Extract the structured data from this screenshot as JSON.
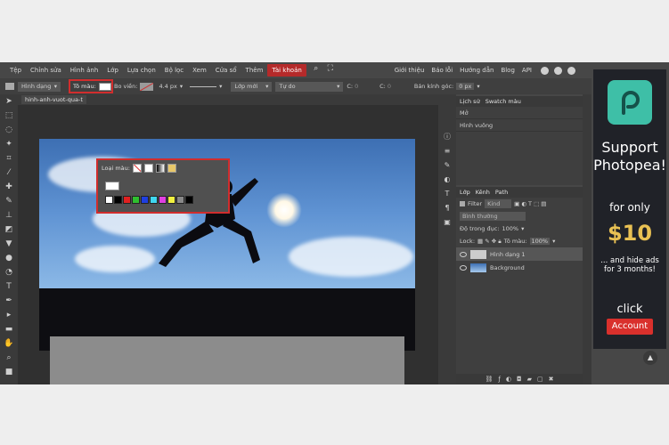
{
  "menu": {
    "items": [
      "Tệp",
      "Chỉnh sửa",
      "Hình ảnh",
      "Lớp",
      "Lựa chọn",
      "Bộ lọc",
      "Xem",
      "Cửa sổ",
      "Thêm",
      "Tài khoản"
    ],
    "right_items": [
      "Giới thiệu",
      "Báo lỗi",
      "Hướng dẫn",
      "Blog",
      "API"
    ]
  },
  "options": {
    "shape_mode": "Hình dạng",
    "fill_label": "Tô màu:",
    "stroke_label": "Bo viền:",
    "stroke_size": "4.4 px",
    "layer_mode": "Lớp mới",
    "free_mode": "Tự do",
    "w_label": "C:",
    "w_value": "0",
    "h_label": "C:",
    "h_value": "0",
    "radius_label": "Bán kính góc:",
    "radius_value": "0 px"
  },
  "document": {
    "tab_name": "hinh-anh-vuot-qua-t"
  },
  "popup": {
    "title": "Loại màu:",
    "swatches": [
      "#ffffff",
      "#000000",
      "#e02020",
      "#2fbf2f",
      "#1f3fe0",
      "#3fd7f0",
      "#e040e0",
      "#f0f040",
      "#888888",
      "#000000"
    ]
  },
  "history": {
    "tabs": [
      "Lịch sử",
      "Swatch màu"
    ],
    "rows": [
      "Mở",
      "Hình vuông"
    ]
  },
  "layers": {
    "tabs": [
      "Lớp",
      "Kênh",
      "Path"
    ],
    "filter_label": "Filter",
    "kind_label": "Kind",
    "blend": "Bình thường",
    "opacity_label": "Độ trong đục:",
    "opacity_value": "100%",
    "lock_label": "Lock:",
    "fill_label": "Tô màu:",
    "fill_value": "100%",
    "items": [
      "Hình dạng 1",
      "Background"
    ]
  },
  "ad": {
    "support": "Support Photopea!",
    "for_only": "for only",
    "price": "$10",
    "hide_text": "... and hide ads for 3 months!",
    "click": "click",
    "button": "Account"
  },
  "colors": {
    "accent": "#d12d2d",
    "panel": "#3f3f3f",
    "logo": "#3ebfa7",
    "price": "#e9c153"
  }
}
